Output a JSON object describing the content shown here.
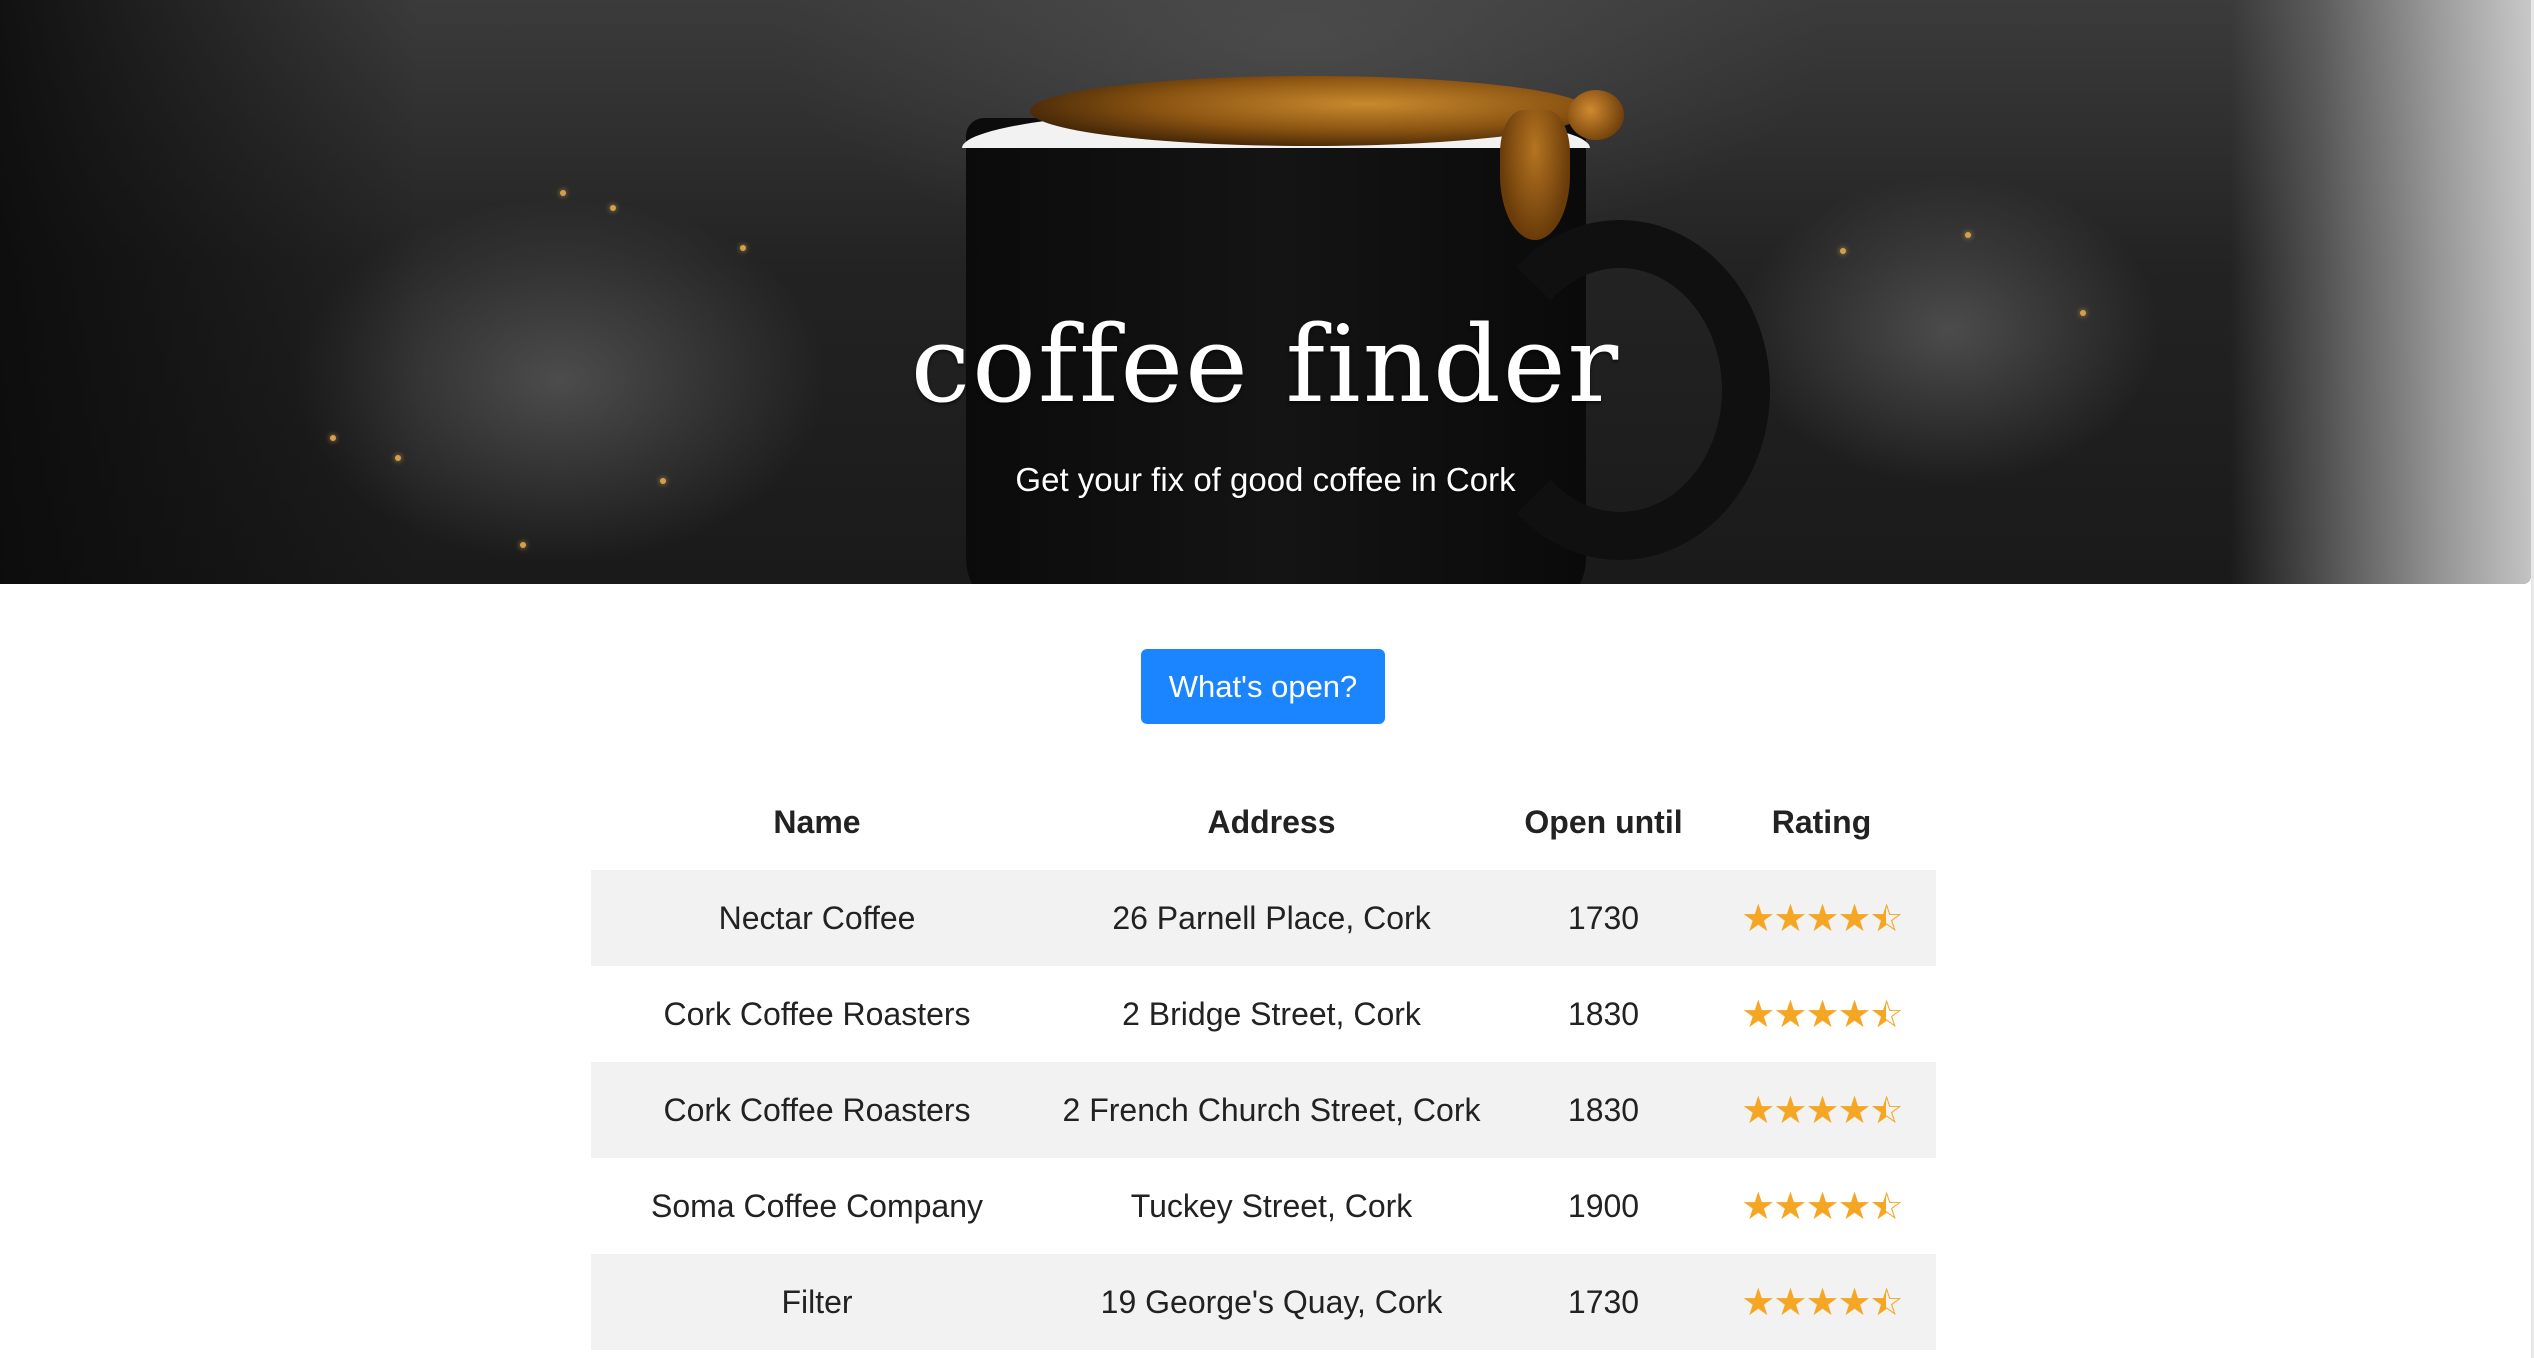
{
  "hero": {
    "title": "coffee finder",
    "subtitle": "Get your fix of good coffee in Cork"
  },
  "actions": {
    "open_button_label": "What's open?"
  },
  "table": {
    "headers": {
      "name": "Name",
      "address": "Address",
      "open_until": "Open until",
      "rating": "Rating"
    },
    "rows": [
      {
        "name": "Nectar Coffee",
        "address": "26 Parnell Place, Cork",
        "open_until": "1730",
        "rating": 4.5
      },
      {
        "name": "Cork Coffee Roasters",
        "address": "2 Bridge Street, Cork",
        "open_until": "1830",
        "rating": 4.5
      },
      {
        "name": "Cork Coffee Roasters",
        "address": "2 French Church Street, Cork",
        "open_until": "1830",
        "rating": 4.5
      },
      {
        "name": "Soma Coffee Company",
        "address": "Tuckey Street, Cork",
        "open_until": "1900",
        "rating": 4.5
      },
      {
        "name": "Filter",
        "address": "19 George's Quay, Cork",
        "open_until": "1730",
        "rating": 4.5
      }
    ]
  },
  "colors": {
    "accent_button": "#1a85ff",
    "star": "#f5a623",
    "row_stripe": "#f2f2f2"
  },
  "icons": {
    "full_star": "star-icon",
    "half_star": "star-half-icon"
  }
}
